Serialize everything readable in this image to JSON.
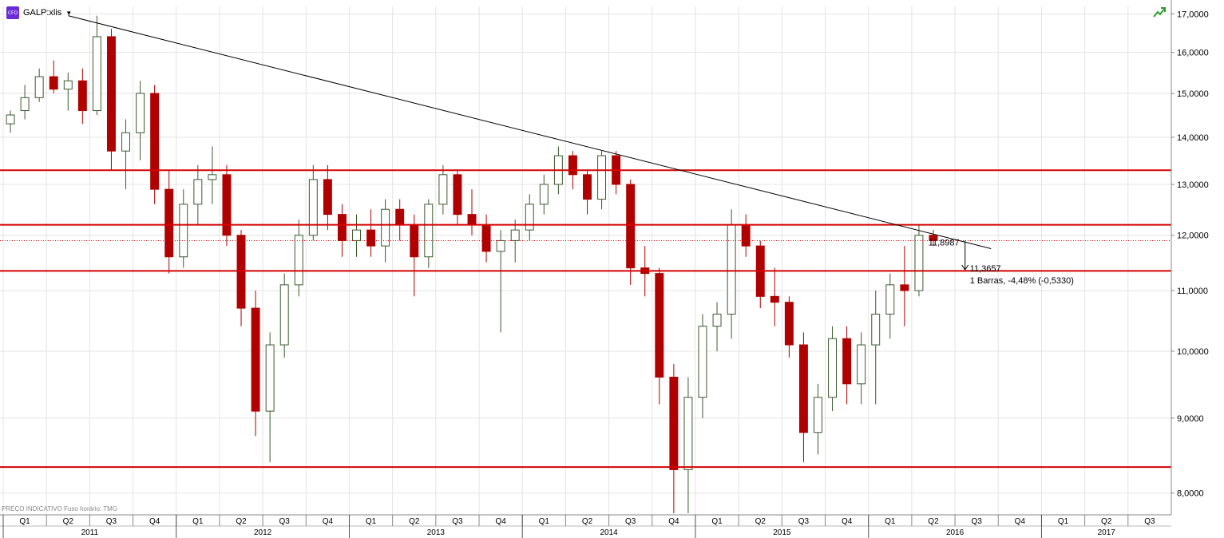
{
  "header": {
    "badge": "CFD",
    "symbol": "GALP:xlis",
    "trend_icon": "trend-up-icon"
  },
  "footnote": "PREÇO INDICATIVO   Fuso horário: TMG",
  "annotations": {
    "last_price": "11,8987",
    "target_price": "11,3657",
    "measure": "1 Barras, -4,48% (-0,5330)"
  },
  "colors": {
    "up_candle": "#3a5a2e",
    "up_candle_fill": "#ffffff",
    "down_candle": "#b00000",
    "hline": "#d40000",
    "trendline": "#000000",
    "grid": "#e4e4e4"
  },
  "chart_data": {
    "type": "candlestick",
    "title": "GALP:xlis",
    "y_axis": {
      "ticks": [
        "8,0000",
        "9,0000",
        "10,0000",
        "11,0000",
        "12,0000",
        "13,0000",
        "14,0000",
        "15,0000",
        "16,0000",
        "17,0000"
      ],
      "tick_values": [
        8,
        9,
        10,
        11,
        12,
        13,
        14,
        15,
        16,
        17
      ],
      "scale": "log",
      "ylim": [
        7.75,
        17.2
      ],
      "side": "right"
    },
    "x_axis": {
      "quarters": [
        "Q1",
        "Q2",
        "Q3",
        "Q4",
        "Q1",
        "Q2",
        "Q3",
        "Q4",
        "Q1",
        "Q2",
        "Q3",
        "Q4",
        "Q1",
        "Q2",
        "Q3",
        "Q4",
        "Q1",
        "Q2",
        "Q3",
        "Q4",
        "Q1",
        "Q2",
        "Q3",
        "Q4",
        "Q1",
        "Q2",
        "Q3"
      ],
      "years": [
        "2011",
        "2012",
        "2013",
        "2014",
        "2015",
        "2016",
        "2017"
      ],
      "range": [
        "2011-01",
        "2017-09"
      ]
    },
    "horizontal_lines": [
      {
        "value": 13.2919,
        "label": "13,2919"
      },
      {
        "value": 12.2,
        "label": "12,2000"
      },
      {
        "value": 11.3456,
        "label": "11,3456"
      },
      {
        "value": 8.3341,
        "label": "8,3341"
      }
    ],
    "current_price_line": {
      "value": 11.8987
    },
    "trendline": {
      "from": {
        "date": "2011-05",
        "value": 16.95
      },
      "to": {
        "date": "2016-09",
        "value": 11.75
      }
    },
    "measure_arrow": {
      "from": 11.8987,
      "to": 11.3657
    },
    "series": [
      {
        "date": "2011-01",
        "values": [
          14.3,
          14.6,
          14.1,
          14.5
        ]
      },
      {
        "date": "2011-02",
        "values": [
          14.6,
          15.2,
          14.4,
          14.9
        ]
      },
      {
        "date": "2011-03",
        "values": [
          14.9,
          15.6,
          14.8,
          15.4
        ]
      },
      {
        "date": "2011-04",
        "values": [
          15.4,
          15.8,
          15.0,
          15.1
        ]
      },
      {
        "date": "2011-05",
        "values": [
          15.1,
          15.5,
          14.6,
          15.3
        ]
      },
      {
        "date": "2011-06",
        "values": [
          15.3,
          15.6,
          14.3,
          14.6
        ]
      },
      {
        "date": "2011-07",
        "values": [
          14.6,
          16.95,
          14.5,
          16.4
        ]
      },
      {
        "date": "2011-08",
        "values": [
          16.4,
          16.6,
          13.3,
          13.7
        ]
      },
      {
        "date": "2011-09",
        "values": [
          13.7,
          14.4,
          12.9,
          14.1
        ]
      },
      {
        "date": "2011-10",
        "values": [
          14.1,
          15.3,
          13.5,
          15.0
        ]
      },
      {
        "date": "2011-11",
        "values": [
          15.0,
          15.2,
          12.6,
          12.9
        ]
      },
      {
        "date": "2011-12",
        "values": [
          12.9,
          13.3,
          11.3,
          11.6
        ]
      },
      {
        "date": "2012-01",
        "values": [
          11.6,
          12.9,
          11.4,
          12.6
        ]
      },
      {
        "date": "2012-02",
        "values": [
          12.6,
          13.4,
          12.2,
          13.1
        ]
      },
      {
        "date": "2012-03",
        "values": [
          13.1,
          13.8,
          12.6,
          13.2
        ]
      },
      {
        "date": "2012-04",
        "values": [
          13.2,
          13.4,
          11.8,
          12.0
        ]
      },
      {
        "date": "2012-05",
        "values": [
          12.0,
          12.1,
          10.4,
          10.7
        ]
      },
      {
        "date": "2012-06",
        "values": [
          10.7,
          11.0,
          8.75,
          9.1
        ]
      },
      {
        "date": "2012-07",
        "values": [
          9.1,
          10.3,
          8.4,
          10.1
        ]
      },
      {
        "date": "2012-08",
        "values": [
          10.1,
          11.3,
          9.9,
          11.1
        ]
      },
      {
        "date": "2012-09",
        "values": [
          11.1,
          12.3,
          10.9,
          12.0
        ]
      },
      {
        "date": "2012-10",
        "values": [
          12.0,
          13.4,
          11.9,
          13.1
        ]
      },
      {
        "date": "2012-11",
        "values": [
          13.1,
          13.4,
          12.1,
          12.4
        ]
      },
      {
        "date": "2012-12",
        "values": [
          12.4,
          12.6,
          11.6,
          11.9
        ]
      },
      {
        "date": "2013-01",
        "values": [
          11.9,
          12.4,
          11.6,
          12.1
        ]
      },
      {
        "date": "2013-02",
        "values": [
          12.1,
          12.5,
          11.6,
          11.8
        ]
      },
      {
        "date": "2013-03",
        "values": [
          11.8,
          12.7,
          11.5,
          12.5
        ]
      },
      {
        "date": "2013-04",
        "values": [
          12.5,
          12.7,
          11.9,
          12.2
        ]
      },
      {
        "date": "2013-05",
        "values": [
          12.2,
          12.4,
          10.9,
          11.6
        ]
      },
      {
        "date": "2013-06",
        "values": [
          11.6,
          12.7,
          11.4,
          12.6
        ]
      },
      {
        "date": "2013-07",
        "values": [
          12.6,
          13.4,
          12.4,
          13.2
        ]
      },
      {
        "date": "2013-08",
        "values": [
          13.2,
          13.3,
          12.2,
          12.4
        ]
      },
      {
        "date": "2013-09",
        "values": [
          12.4,
          12.9,
          12.0,
          12.2
        ]
      },
      {
        "date": "2013-10",
        "values": [
          12.2,
          12.4,
          11.5,
          11.7
        ]
      },
      {
        "date": "2013-11",
        "values": [
          11.7,
          12.1,
          10.3,
          11.9
        ]
      },
      {
        "date": "2013-12",
        "values": [
          11.9,
          12.3,
          11.5,
          12.1
        ]
      },
      {
        "date": "2014-01",
        "values": [
          12.1,
          12.8,
          11.9,
          12.6
        ]
      },
      {
        "date": "2014-02",
        "values": [
          12.6,
          13.2,
          12.4,
          13.0
        ]
      },
      {
        "date": "2014-03",
        "values": [
          13.0,
          13.8,
          12.8,
          13.6
        ]
      },
      {
        "date": "2014-04",
        "values": [
          13.6,
          13.7,
          12.9,
          13.2
        ]
      },
      {
        "date": "2014-05",
        "values": [
          13.2,
          13.3,
          12.4,
          12.7
        ]
      },
      {
        "date": "2014-06",
        "values": [
          12.7,
          13.7,
          12.5,
          13.6
        ]
      },
      {
        "date": "2014-07",
        "values": [
          13.6,
          13.7,
          12.8,
          13.0
        ]
      },
      {
        "date": "2014-08",
        "values": [
          13.0,
          13.1,
          11.1,
          11.4
        ]
      },
      {
        "date": "2014-09",
        "values": [
          11.4,
          11.8,
          10.9,
          11.3
        ]
      },
      {
        "date": "2014-10",
        "values": [
          11.3,
          11.4,
          9.2,
          9.6
        ]
      },
      {
        "date": "2014-11",
        "values": [
          9.6,
          9.8,
          7.75,
          8.3
        ]
      },
      {
        "date": "2014-12",
        "values": [
          8.3,
          9.6,
          7.75,
          9.3
        ]
      },
      {
        "date": "2015-01",
        "values": [
          9.3,
          10.6,
          9.0,
          10.4
        ]
      },
      {
        "date": "2015-02",
        "values": [
          10.4,
          10.8,
          10.0,
          10.6
        ]
      },
      {
        "date": "2015-03",
        "values": [
          10.6,
          12.5,
          10.2,
          12.2
        ]
      },
      {
        "date": "2015-04",
        "values": [
          12.2,
          12.4,
          11.6,
          11.8
        ]
      },
      {
        "date": "2015-05",
        "values": [
          11.8,
          11.9,
          10.7,
          10.9
        ]
      },
      {
        "date": "2015-06",
        "values": [
          10.9,
          11.4,
          10.4,
          10.8
        ]
      },
      {
        "date": "2015-07",
        "values": [
          10.8,
          10.9,
          9.9,
          10.1
        ]
      },
      {
        "date": "2015-08",
        "values": [
          10.1,
          10.3,
          8.4,
          8.8
        ]
      },
      {
        "date": "2015-09",
        "values": [
          8.8,
          9.5,
          8.5,
          9.3
        ]
      },
      {
        "date": "2015-10",
        "values": [
          9.3,
          10.4,
          9.1,
          10.2
        ]
      },
      {
        "date": "2015-11",
        "values": [
          10.2,
          10.4,
          9.2,
          9.5
        ]
      },
      {
        "date": "2015-12",
        "values": [
          9.5,
          10.3,
          9.2,
          10.1
        ]
      },
      {
        "date": "2016-01",
        "values": [
          10.1,
          11.0,
          9.2,
          10.6
        ]
      },
      {
        "date": "2016-02",
        "values": [
          10.6,
          11.3,
          10.2,
          11.1
        ]
      },
      {
        "date": "2016-03",
        "values": [
          11.1,
          11.8,
          10.4,
          11.0
        ]
      },
      {
        "date": "2016-04",
        "values": [
          11.0,
          12.2,
          10.9,
          12.0
        ]
      },
      {
        "date": "2016-05",
        "values": [
          12.0,
          12.1,
          11.8,
          11.9
        ]
      }
    ]
  }
}
